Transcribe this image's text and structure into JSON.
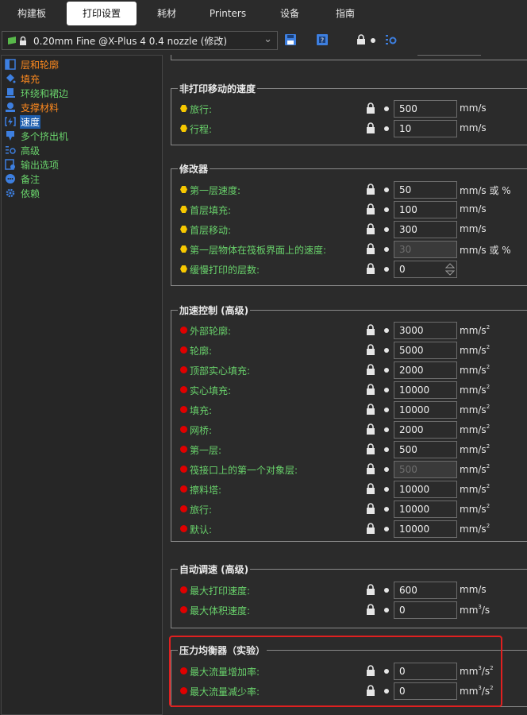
{
  "tabs": [
    {
      "label": "构建板",
      "active": false
    },
    {
      "label": "打印设置",
      "active": true
    },
    {
      "label": "耗材",
      "active": false
    },
    {
      "label": "Printers",
      "active": false
    },
    {
      "label": "设备",
      "active": false
    },
    {
      "label": "指南",
      "active": false
    }
  ],
  "toolbar": {
    "preset_label": "0.20mm Fine @X-Plus 4 0.4 nozzle (修改)"
  },
  "sidebar": {
    "items": [
      {
        "label": "层和轮廓",
        "color": "#ff8a1e"
      },
      {
        "label": "填充",
        "color": "#ff8a1e"
      },
      {
        "label": "环绕和裙边",
        "color": "#69d26b"
      },
      {
        "label": "支撑材料",
        "color": "#ff8a1e"
      },
      {
        "label": "速度",
        "color": "#ffffff"
      },
      {
        "label": "多个挤出机",
        "color": "#69d26b"
      },
      {
        "label": "高级",
        "color": "#69d26b"
      },
      {
        "label": "输出选项",
        "color": "#69d26b"
      },
      {
        "label": "备注",
        "color": "#69d26b"
      },
      {
        "label": "依赖",
        "color": "#69d26b"
      }
    ]
  },
  "groups": {
    "non_print": {
      "title": "非打印移动的速度",
      "rows": [
        {
          "label": "旅行:",
          "value": "500",
          "unit": "mm/s"
        },
        {
          "label": "行程:",
          "value": "10",
          "unit": "mm/s"
        }
      ]
    },
    "modifiers": {
      "title": "修改器",
      "rows": [
        {
          "label": "第一层速度:",
          "value": "50",
          "unit": "mm/s 或 %"
        },
        {
          "label": "首层填充:",
          "value": "100",
          "unit": "mm/s"
        },
        {
          "label": "首层移动:",
          "value": "300",
          "unit": "mm/s"
        },
        {
          "label": "第一层物体在筏板界面上的速度:",
          "value": "30",
          "unit": "mm/s 或 %"
        },
        {
          "label": "缓慢打印的层数:",
          "value": "0",
          "unit": ""
        }
      ]
    },
    "accel": {
      "title": "加速控制 (高级)",
      "unit_base": "mm/s",
      "unit_exp": "2",
      "rows": [
        {
          "label": "外部轮廓:",
          "value": "3000"
        },
        {
          "label": "轮廓:",
          "value": "5000"
        },
        {
          "label": "顶部实心填充:",
          "value": "2000"
        },
        {
          "label": "实心填充:",
          "value": "10000"
        },
        {
          "label": "填充:",
          "value": "10000"
        },
        {
          "label": "网桥:",
          "value": "2000"
        },
        {
          "label": "第一层:",
          "value": "500"
        },
        {
          "label": "筏接口上的第一个对象层:",
          "value": "500"
        },
        {
          "label": "擦料塔:",
          "value": "10000"
        },
        {
          "label": "旅行:",
          "value": "10000"
        },
        {
          "label": "默认:",
          "value": "10000"
        }
      ]
    },
    "autospeed": {
      "title": "自动调速 (高级)",
      "rows": [
        {
          "label": "最大打印速度:",
          "value": "600",
          "unit": "mm/s"
        },
        {
          "label": "最大体积速度:",
          "value": "0",
          "unit_base": "mm",
          "unit_exp": "3",
          "unit_tail": "/s"
        }
      ]
    },
    "pressure": {
      "title": "压力均衡器（实验）",
      "unit_base": "mm",
      "unit_exp1": "3",
      "unit_mid": "/s",
      "unit_exp2": "2",
      "rows": [
        {
          "label": "最大流量增加率:",
          "value": "0"
        },
        {
          "label": "最大流量减少率:",
          "value": "0"
        }
      ]
    }
  },
  "colors": {
    "yellow_bullet": "#f7c800",
    "red_bullet": "#e00000",
    "green_label": "#69d26b",
    "highlight_border": "#e02020"
  }
}
